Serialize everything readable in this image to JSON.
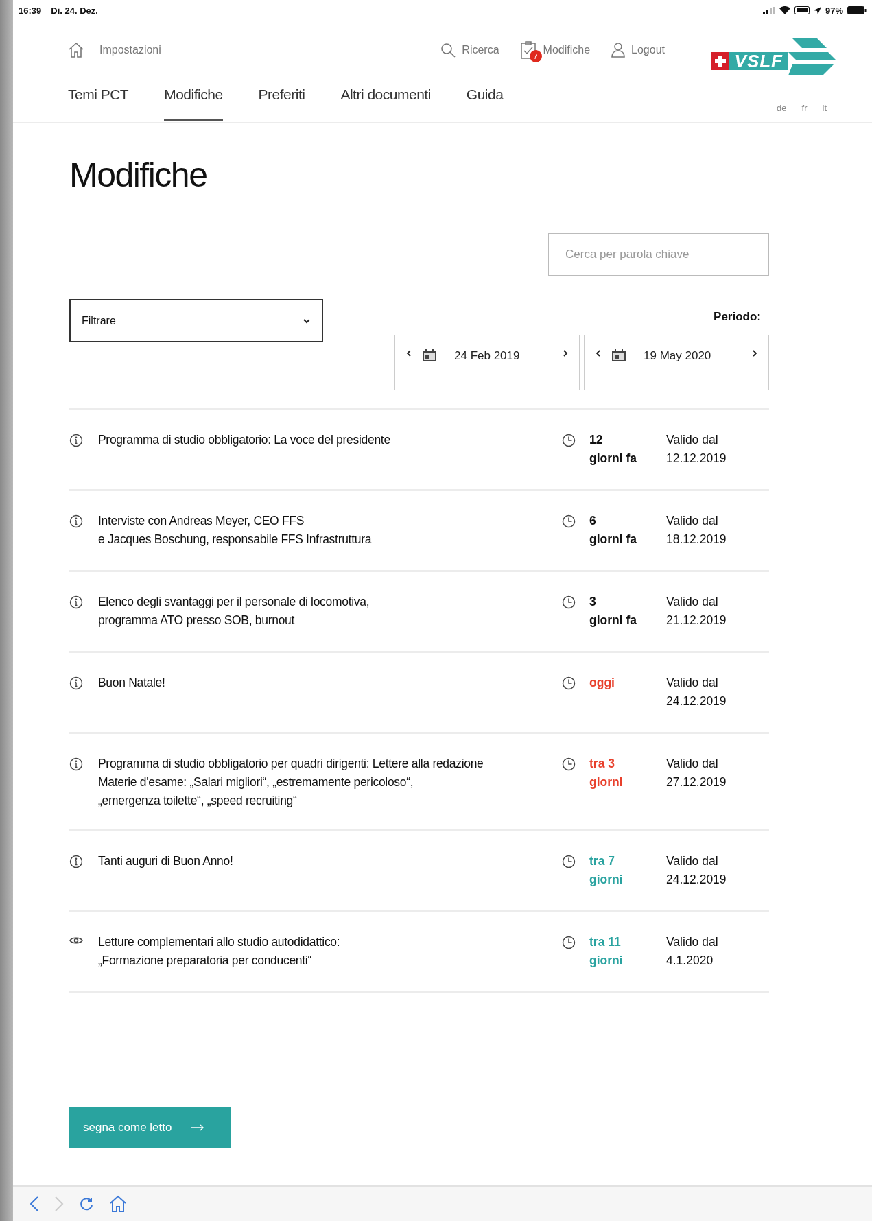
{
  "status_bar": {
    "time": "16:39",
    "date": "Di. 24. Dez.",
    "battery": "97%"
  },
  "header": {
    "settings": "Impostazioni",
    "actions": [
      {
        "kind": "search",
        "label": "Ricerca"
      },
      {
        "kind": "changes",
        "label": "Modifiche",
        "badge": "7"
      },
      {
        "kind": "user",
        "label": "Logout"
      }
    ],
    "logo": "VSLF"
  },
  "tabs": [
    {
      "label": "Temi PCT",
      "selected": false
    },
    {
      "label": "Modifiche",
      "selected": true
    },
    {
      "label": "Preferiti",
      "selected": false
    },
    {
      "label": "Altri documenti",
      "selected": false
    },
    {
      "label": "Guida",
      "selected": false
    }
  ],
  "languages": [
    {
      "label": "de",
      "selected": false
    },
    {
      "label": "fr",
      "selected": false
    },
    {
      "label": "it",
      "selected": true
    }
  ],
  "title": "Modifiche",
  "search": {
    "placeholder": "Cerca per parola chiave"
  },
  "filter": {
    "value": "Filtrare"
  },
  "period": {
    "label": "Periodo:",
    "from": "24 Feb 2019",
    "to": "19 May 2020"
  },
  "items": [
    {
      "kind": "info",
      "title": "Programma di studio obbligatorio: La voce del presidente",
      "when": [
        "12",
        "giorni fa"
      ],
      "color": "#111111",
      "valid_label": "Valido dal",
      "valid_date": "12.12.2019"
    },
    {
      "kind": "info",
      "title": "Interviste con Andreas Meyer, CEO FFS\ne Jacques Boschung, responsabile FFS Infrastruttura",
      "when": [
        "6",
        "giorni fa"
      ],
      "color": "#111111",
      "valid_label": "Valido dal",
      "valid_date": "18.12.2019"
    },
    {
      "kind": "info",
      "title": "Elenco degli svantaggi per il personale di locomotiva,\nprogramma ATO presso SOB, burnout",
      "when": [
        "3",
        "giorni fa"
      ],
      "color": "#111111",
      "valid_label": "Valido dal",
      "valid_date": "21.12.2019"
    },
    {
      "kind": "info",
      "title": "Buon Natale!",
      "when": [
        "oggi"
      ],
      "color": "#e8402c",
      "valid_label": "Valido dal",
      "valid_date": "24.12.2019"
    },
    {
      "kind": "info",
      "title": "Programma di studio obbligatorio per quadri dirigenti: Lettere alla redazione\nMaterie d'esame: „Salari migliori“, „estremamente pericoloso“,\n„emergenza toilette“, „speed recruiting“",
      "when": [
        "tra 3",
        "giorni"
      ],
      "color": "#e8402c",
      "valid_label": "Valido dal",
      "valid_date": "27.12.2019"
    },
    {
      "kind": "info",
      "title": "Tanti auguri di Buon Anno!",
      "when": [
        "tra 7",
        "giorni"
      ],
      "color": "#2aa3a0",
      "valid_label": "Valido dal",
      "valid_date": "24.12.2019"
    },
    {
      "kind": "read",
      "title": "Letture complementari allo studio autodidattico:\n„Formazione preparatoria per conducenti“",
      "when": [
        "tra 11",
        "giorni"
      ],
      "color": "#2aa3a0",
      "valid_label": "Valido dal",
      "valid_date": "4.1.2020"
    }
  ],
  "mark_read_button": "segna come letto"
}
